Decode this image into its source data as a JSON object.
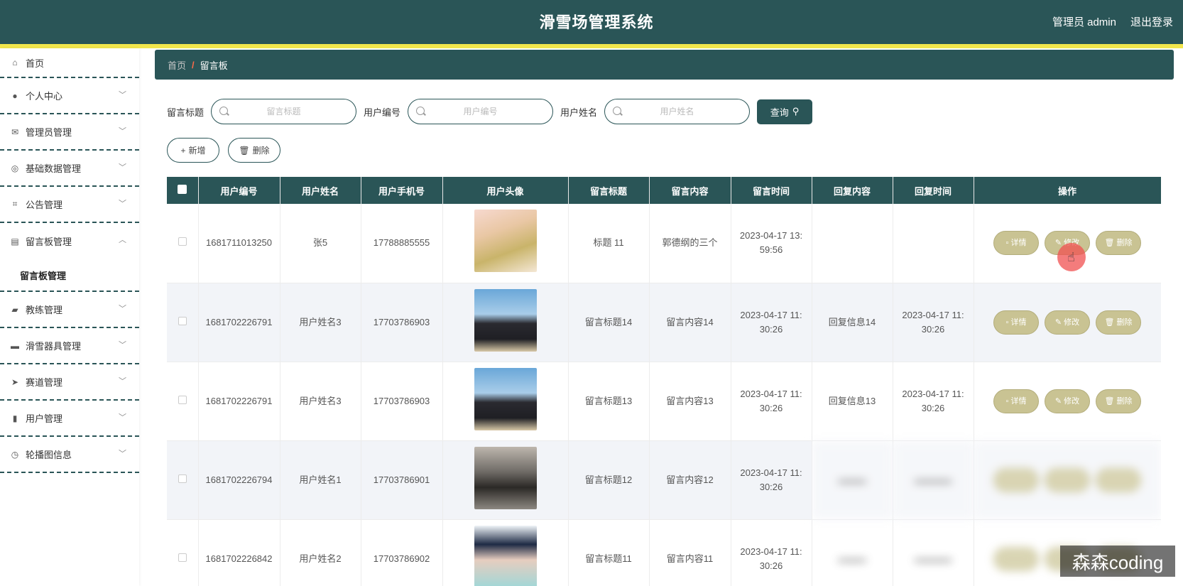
{
  "header": {
    "title": "滑雪场管理系统",
    "user_label": "管理员 admin",
    "logout_label": "退出登录"
  },
  "sidebar": {
    "items": [
      {
        "label": "首页",
        "icon": "home-icon"
      },
      {
        "label": "个人中心",
        "icon": "user-icon"
      },
      {
        "label": "管理员管理",
        "icon": "mail-icon"
      },
      {
        "label": "基础数据管理",
        "icon": "compass-icon"
      },
      {
        "label": "公告管理",
        "icon": "crop-icon"
      },
      {
        "label": "留言板管理",
        "icon": "briefcase-icon",
        "expanded": true
      },
      {
        "label": "教练管理",
        "icon": "ticket-icon"
      },
      {
        "label": "滑雪器具管理",
        "icon": "device-icon"
      },
      {
        "label": "赛道管理",
        "icon": "send-icon"
      },
      {
        "label": "用户管理",
        "icon": "clipboard-icon"
      },
      {
        "label": "轮播图信息",
        "icon": "clock-icon"
      }
    ],
    "submenu_label": "留言板管理"
  },
  "breadcrumb": {
    "home": "首页",
    "separator": "/",
    "current": "留言板"
  },
  "search": {
    "title_label": "留言标题",
    "title_placeholder": "留言标题",
    "userid_label": "用户编号",
    "userid_placeholder": "用户编号",
    "username_label": "用户姓名",
    "username_placeholder": "用户姓名",
    "query_label": "查询"
  },
  "actions": {
    "add_label": "新增",
    "delete_label": "删除"
  },
  "table": {
    "columns": [
      "用户编号",
      "用户姓名",
      "用户手机号",
      "用户头像",
      "留言标题",
      "留言内容",
      "留言时间",
      "回复内容",
      "回复时间",
      "操作"
    ],
    "rows": [
      {
        "user_no": "1681711013250",
        "name": "张5",
        "phone": "17788885555",
        "title": "标题 11",
        "content": "郭德纲的三个",
        "time_a": "2023-04-17 13:",
        "time_b": "59:56",
        "reply": "",
        "reply_time_a": "",
        "reply_time_b": ""
      },
      {
        "user_no": "1681702226791",
        "name": "用户姓名3",
        "phone": "17703786903",
        "title": "留言标题14",
        "content": "留言内容14",
        "time_a": "2023-04-17 11:",
        "time_b": "30:26",
        "reply": "回复信息14",
        "reply_time_a": "2023-04-17 11:",
        "reply_time_b": "30:26"
      },
      {
        "user_no": "1681702226791",
        "name": "用户姓名3",
        "phone": "17703786903",
        "title": "留言标题13",
        "content": "留言内容13",
        "time_a": "2023-04-17 11:",
        "time_b": "30:26",
        "reply": "回复信息13",
        "reply_time_a": "2023-04-17 11:",
        "reply_time_b": "30:26"
      },
      {
        "user_no": "1681702226794",
        "name": "用户姓名1",
        "phone": "17703786901",
        "title": "留言标题12",
        "content": "留言内容12",
        "time_a": "2023-04-17 11:",
        "time_b": "30:26",
        "reply": "",
        "reply_time_a": "",
        "reply_time_b": ""
      },
      {
        "user_no": "1681702226842",
        "name": "用户姓名2",
        "phone": "17703786902",
        "title": "留言标题11",
        "content": "留言内容11",
        "time_a": "2023-04-17 11:",
        "time_b": "30:26",
        "reply": "",
        "reply_time_a": "",
        "reply_time_b": ""
      }
    ],
    "op_labels": {
      "detail": "详情",
      "edit": "修改",
      "delete": "删除"
    }
  },
  "watermark": "森森coding",
  "colors": {
    "primary": "#2a5557",
    "accent": "#f2e64c",
    "op_button": "#c9c393"
  }
}
